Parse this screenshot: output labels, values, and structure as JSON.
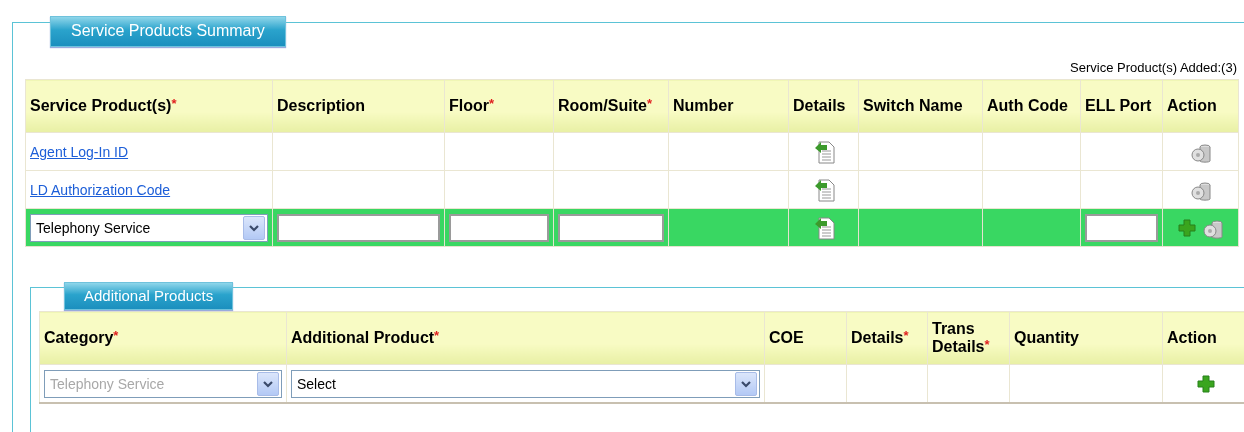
{
  "service_products": {
    "legend": "Service Products Summary",
    "count_label": "Service Product(s) Added:(3)",
    "columns": [
      {
        "label": "Service Product(s)",
        "mark": "*"
      },
      {
        "label": "Description"
      },
      {
        "label": "Floor",
        "mark": "*"
      },
      {
        "label": "Room/Suite",
        "mark": "*"
      },
      {
        "label": "Number"
      },
      {
        "label": "Details"
      },
      {
        "label": "Switch Name"
      },
      {
        "label": "Auth Code"
      },
      {
        "label": "ELL Port"
      },
      {
        "label": "Action"
      }
    ],
    "rows": [
      {
        "selected": false,
        "cells": [
          {
            "kind": "link",
            "text": "Agent Log-In ID"
          },
          {
            "kind": "blank"
          },
          {
            "kind": "blank"
          },
          {
            "kind": "blank"
          },
          {
            "kind": "blank"
          },
          {
            "kind": "details"
          },
          {
            "kind": "blank"
          },
          {
            "kind": "blank"
          },
          {
            "kind": "blank"
          },
          {
            "kind": "action",
            "add": false
          }
        ]
      },
      {
        "selected": false,
        "cells": [
          {
            "kind": "link",
            "text": "LD Authorization Code"
          },
          {
            "kind": "blank"
          },
          {
            "kind": "blank"
          },
          {
            "kind": "blank"
          },
          {
            "kind": "blank"
          },
          {
            "kind": "details"
          },
          {
            "kind": "blank"
          },
          {
            "kind": "blank"
          },
          {
            "kind": "blank"
          },
          {
            "kind": "action",
            "add": false
          }
        ]
      },
      {
        "selected": true,
        "cells": [
          {
            "kind": "select",
            "value": "Telephony Service",
            "disabled": false
          },
          {
            "kind": "input"
          },
          {
            "kind": "input"
          },
          {
            "kind": "input"
          },
          {
            "kind": "blank"
          },
          {
            "kind": "details"
          },
          {
            "kind": "blank"
          },
          {
            "kind": "blank"
          },
          {
            "kind": "input"
          },
          {
            "kind": "action",
            "add": true
          }
        ]
      }
    ]
  },
  "additional_products": {
    "legend": "Additional Products",
    "columns": [
      {
        "label": "Category",
        "mark": "*"
      },
      {
        "label": "Additional Product",
        "mark": "*"
      },
      {
        "label": "COE"
      },
      {
        "label": "Details",
        "mark": "*"
      },
      {
        "label": "Trans Details",
        "mark": "*"
      },
      {
        "label": "Quantity"
      },
      {
        "label": "Action"
      }
    ],
    "rows": [
      {
        "selected": false,
        "cells": [
          {
            "kind": "select",
            "value": "Telephony Service",
            "disabled": true
          },
          {
            "kind": "select",
            "value": "Select",
            "disabled": false
          },
          {
            "kind": "blank"
          },
          {
            "kind": "blank"
          },
          {
            "kind": "blank"
          },
          {
            "kind": "blank"
          },
          {
            "kind": "add"
          }
        ]
      }
    ]
  }
}
